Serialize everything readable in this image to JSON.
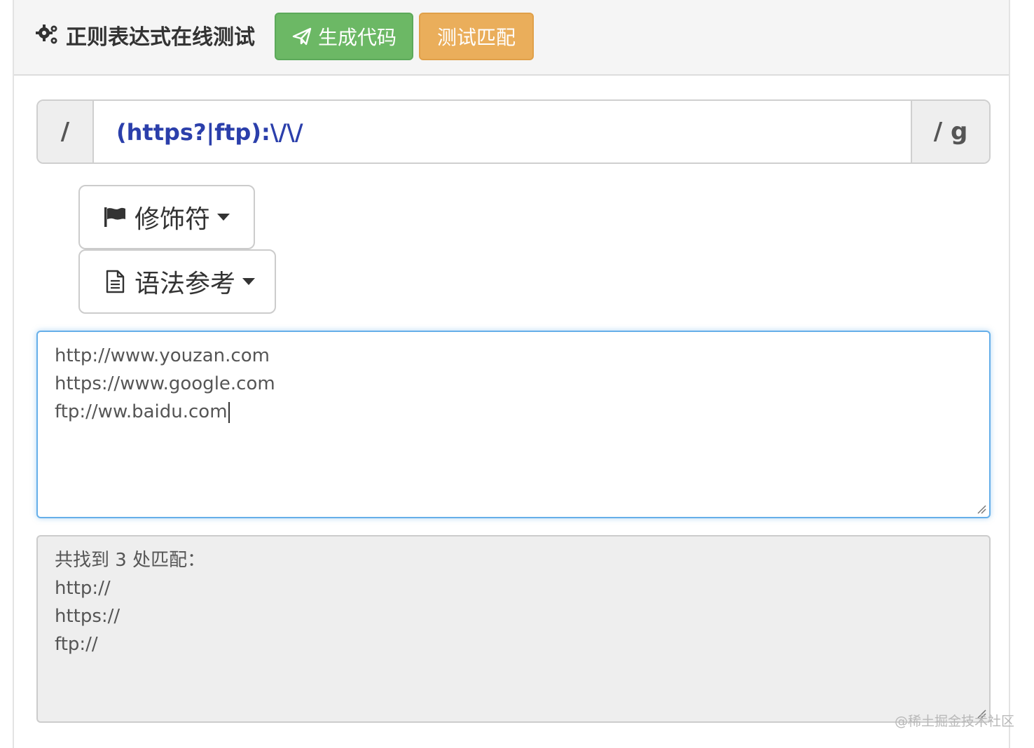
{
  "header": {
    "title": "正则表达式在线测试",
    "title_icon": "gears-icon",
    "generate_button": "生成代码",
    "generate_icon": "paper-plane-icon",
    "test_button": "测试匹配",
    "generate_color": "#6cb865",
    "test_color": "#eaae5b"
  },
  "regex": {
    "prefix": "/",
    "pattern": "(https?|ftp):\\/\\/",
    "suffix": "/ g",
    "pattern_color": "#2b3fab"
  },
  "dropdowns": {
    "flags_label": "修饰符",
    "flags_icon": "flag-icon",
    "syntax_label": "语法参考",
    "syntax_icon": "document-icon"
  },
  "input_text": {
    "lines": [
      "http://www.youzan.com",
      "https://www.google.com",
      "ftp://ww.baidu.com"
    ]
  },
  "result": {
    "summary": "共找到 3 处匹配：",
    "matches": [
      "http://",
      "https://",
      "ftp://"
    ]
  },
  "watermark": "@稀土掘金技术社区"
}
